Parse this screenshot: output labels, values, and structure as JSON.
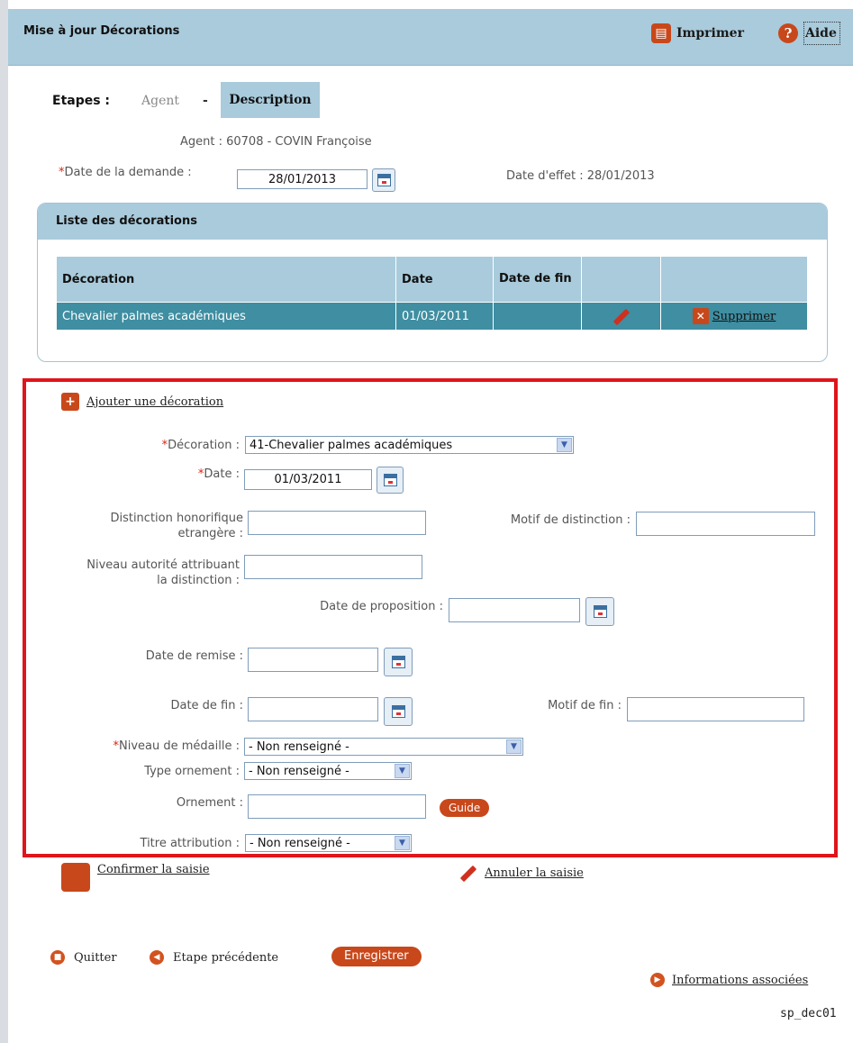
{
  "header": {
    "title": "Mise à jour Décorations",
    "print_label": "Imprimer",
    "help_label": "Aide"
  },
  "steps": {
    "label": "Etapes :",
    "agent": "Agent",
    "separator": "-",
    "description": "Description"
  },
  "agent_line": "Agent : 60708 - COVIN Françoise",
  "demande": {
    "label": "Date de la demande :",
    "value": "28/01/2013"
  },
  "effet": "Date d'effet : 28/01/2013",
  "list": {
    "title": "Liste des décorations",
    "columns": [
      "Décoration",
      "Date",
      "Date de fin",
      "",
      ""
    ],
    "rows": [
      {
        "decoration": "Chevalier palmes académiques",
        "date": "01/03/2011",
        "date_fin": "",
        "delete_label": "Supprimer"
      }
    ]
  },
  "form": {
    "add_label": "Ajouter une décoration",
    "decoration_label": "Décoration :",
    "decoration_value": "41-Chevalier palmes académiques",
    "date_label": "Date :",
    "date_value": "01/03/2011",
    "distinction_label_1": "Distinction honorifique",
    "distinction_label_2": "etrangère :",
    "motif_distinction_label": "Motif de distinction :",
    "niveau_autorite_label_1": "Niveau autorité attribuant",
    "niveau_autorite_label_2": "la distinction :",
    "date_proposition_label": "Date de proposition :",
    "date_remise_label": "Date de remise :",
    "date_fin_label": "Date de fin :",
    "motif_fin_label": "Motif de fin :",
    "niveau_medaille_label": "Niveau de médaille :",
    "niveau_medaille_value": "- Non renseigné -",
    "type_ornement_label": "Type ornement :",
    "type_ornement_value": "- Non renseigné -",
    "ornement_label": "Ornement :",
    "guide_label": "Guide",
    "titre_attribution_label": "Titre attribution :",
    "titre_attribution_value": "- Non renseigné -",
    "required_mark": "*"
  },
  "actions": {
    "confirm": "Confirmer la saisie",
    "cancel": "Annuler la saisie"
  },
  "footer": {
    "quit": "Quitter",
    "previous": "Etape précédente",
    "save": "Enregistrer",
    "info": "Informations associées",
    "screen_code": "sp_dec01"
  },
  "colors": {
    "header_bg": "#a9cbdc",
    "row_bg": "#3f8ea1",
    "accent": "#c8481b",
    "highlight_border": "#e0141b"
  }
}
